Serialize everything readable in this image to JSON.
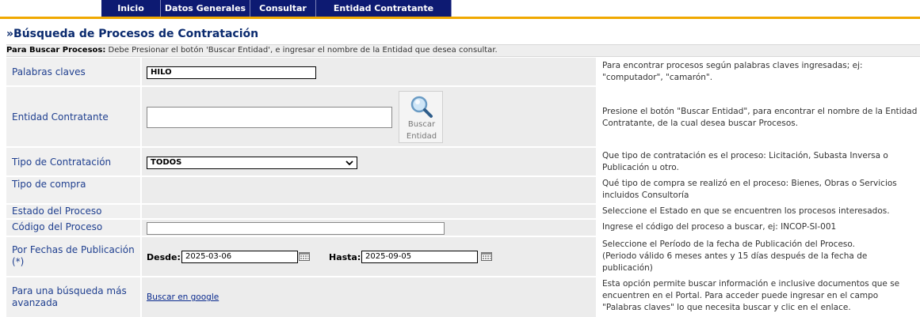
{
  "menu": {
    "items": [
      {
        "label": "Inicio"
      },
      {
        "label": "Datos Generales"
      },
      {
        "label": "Consultar"
      },
      {
        "label": "Entidad Contratante"
      }
    ]
  },
  "page": {
    "title": "»Búsqueda de Procesos de Contratación",
    "instr_bold": "Para Buscar Procesos:",
    "instr_text": " Debe Presionar el botón 'Buscar Entidad', e ingresar el nombre de la Entidad que desea consultar."
  },
  "form": {
    "palabras": {
      "label": "Palabras claves",
      "value": "HILO",
      "help_1": "Para encontrar procesos según palabras claves ingresadas; ej:",
      "help_2": "\"computador\", \"camarón\"."
    },
    "entidad": {
      "label": "Entidad Contratante",
      "value": "",
      "button_1": "Buscar",
      "button_2": "Entidad",
      "help_1": "Presione el botón \"Buscar Entidad\", para encontrar el nombre de la Entidad",
      "help_2": "Contratante, de la cual desea buscar Procesos."
    },
    "tipo_contratacion": {
      "label": "Tipo de Contratación",
      "selected": "TODOS",
      "help_1": "Que tipo de contratación es el proceso: Licitación, Subasta Inversa o",
      "help_2": "Publicación u otro."
    },
    "tipo_compra": {
      "label": "Tipo de compra",
      "help_1": "Qué tipo de compra se realizó en el proceso: Bienes, Obras o Servicios",
      "help_2": "incluidos Consultoría"
    },
    "estado": {
      "label": "Estado del Proceso",
      "help_1": "Seleccione el Estado en que se encuentren los procesos interesados."
    },
    "codigo": {
      "label": "Código del Proceso",
      "value": "",
      "help_1": "Ingrese el código del proceso a buscar, ej: INCOP-SI-001"
    },
    "fechas": {
      "label_1": "Por Fechas de Publicación",
      "label_2": "(*)",
      "desde_label": "Desde:",
      "desde_value": "2025-03-06",
      "hasta_label": "Hasta:",
      "hasta_value": "2025-09-05",
      "help_1": "Seleccione el Período de la fecha de Publicación del Proceso.",
      "help_2": "(Periodo válido 6 meses antes y 15 días después de la fecha de",
      "help_3": "publicación)"
    },
    "avanzada": {
      "label_1": "Para una búsqueda más",
      "label_2": "avanzada",
      "link": "Buscar en google",
      "help_1": "Esta opción permite buscar información e inclusive documentos que se",
      "help_2": "encuentren en el Portal. Para acceder puede ingresar en el campo",
      "help_3": "\"Palabras claves\" lo que necesita buscar y clic en el enlace."
    }
  }
}
